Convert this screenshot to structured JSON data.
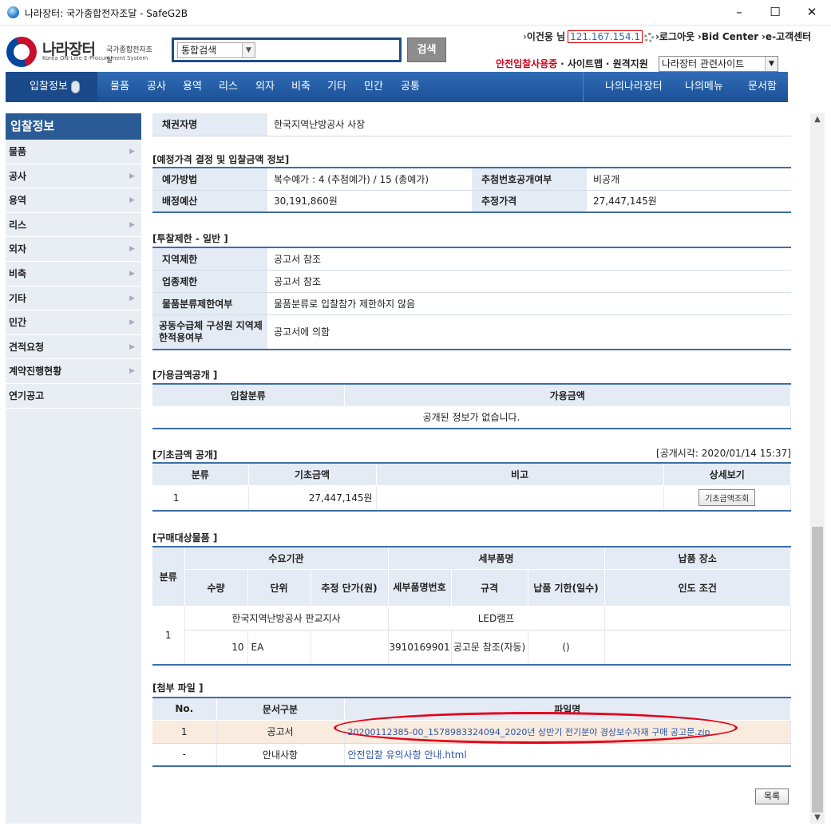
{
  "window": {
    "title": "나라장터: 국가종합전자조달 - SafeG2B",
    "minimize": "–",
    "maximize": "☐",
    "close": "✕"
  },
  "logo": {
    "main": "나라장터",
    "sub": "국가종합전자조달",
    "en": "Korea ON-Line E-Procurement System"
  },
  "search": {
    "category": "통합검색",
    "query": "",
    "button": "검색"
  },
  "user": {
    "prefix": "›",
    "name": "이건웅 님",
    "ip": "121.167.154.1"
  },
  "top_links": {
    "logout": "›로그아웃",
    "bid_center": "›Bid Center",
    "customer_center": "›e-고객센터"
  },
  "util_links": {
    "safe_bid": "안전입찰사용중",
    "sitemap": "· 사이트맵",
    "remote": "· 원격지원"
  },
  "related_site": "나라장터 관련사이트",
  "nav": {
    "first": "입찰정보",
    "items": [
      "물품",
      "공사",
      "용역",
      "리스",
      "외자",
      "비축",
      "기타",
      "민간",
      "공통"
    ],
    "right": [
      "나의나라장터",
      "나의메뉴",
      "문서함"
    ]
  },
  "sidebar": {
    "title": "입찰정보",
    "items": [
      "물품",
      "공사",
      "용역",
      "리스",
      "외자",
      "비축",
      "기타",
      "민간",
      "견적요청",
      "계약진행현황",
      "연기공고"
    ]
  },
  "creditor": {
    "label": "채권자명",
    "value": "한국지역난방공사 사장"
  },
  "price_section": {
    "title": "[예정가격 결정 및 입찰금액 정보]",
    "method_label": "예가방법",
    "method_value": "복수예가 : 4 (추첨예가) / 15 (총예가)",
    "draw_public_label": "추첨번호공개여부",
    "draw_public_value": "비공개",
    "budget_label": "배정예산",
    "budget_value": "30,191,860원",
    "estimate_label": "추정가격",
    "estimate_value": "27,447,145원"
  },
  "restriction_section": {
    "title": "[투찰제한 - 일반 ]",
    "rows": [
      {
        "label": "지역제한",
        "value": "공고서 참조"
      },
      {
        "label": "업종제한",
        "value": "공고서 참조"
      },
      {
        "label": "물품분류제한여부",
        "value": "물품분류로 입찰참가 제한하지 않음"
      },
      {
        "label": "공동수급체 구성원 지역제한적용여부",
        "value": "공고서에 의함"
      }
    ]
  },
  "available_section": {
    "title": "[가용금액공개 ]",
    "headers": [
      "입찰분류",
      "가용금액"
    ],
    "empty": "공개된 정보가 없습니다."
  },
  "base_section": {
    "title": "[기초금액 공개]",
    "timestamp": "[공개시각: 2020/01/14 15:37]",
    "headers": [
      "분류",
      "기초금액",
      "비고",
      "상세보기"
    ],
    "row": {
      "no": "1",
      "amount": "27,447,145원",
      "note": "",
      "button": "기초금액조회"
    }
  },
  "goods_section": {
    "title": "[구매대상물품 ]",
    "h_category": "분류",
    "h_agency": "수요기관",
    "h_item": "세부품명",
    "h_place": "납품 장소",
    "h_qty": "수량",
    "h_unit": "단위",
    "h_price": "추정 단가(원)",
    "h_itemno": "세부품명번호",
    "h_spec": "규격",
    "h_due": "납품 기한(일수)",
    "h_terms": "인도 조건",
    "row": {
      "no": "1",
      "agency": "한국지역난방공사 판교지사",
      "item": "LED램프",
      "qty": "10",
      "unit": "EA",
      "price": "",
      "itemno": "3910169901",
      "spec": "공고문 참조(자동)",
      "due": "()"
    }
  },
  "files_section": {
    "title": "[첨부 파일 ]",
    "headers": [
      "No.",
      "문서구분",
      "파일명"
    ],
    "rows": [
      {
        "no": "1",
        "type": "공고서",
        "name": "20200112385-00_1578983324094_2020년 상반기 전기분야 경상보수자재 구매 공고문.zip"
      },
      {
        "no": "-",
        "type": "안내사항",
        "name": "안전입찰 유의사항 안내.html"
      }
    ]
  },
  "list_button": "목록",
  "colors": {
    "nav": "#1c5097",
    "header_cell": "#e4ebf4",
    "highlight_row": "#f9ebde",
    "annotation": "#e4001b",
    "link": "#2d55a6"
  }
}
